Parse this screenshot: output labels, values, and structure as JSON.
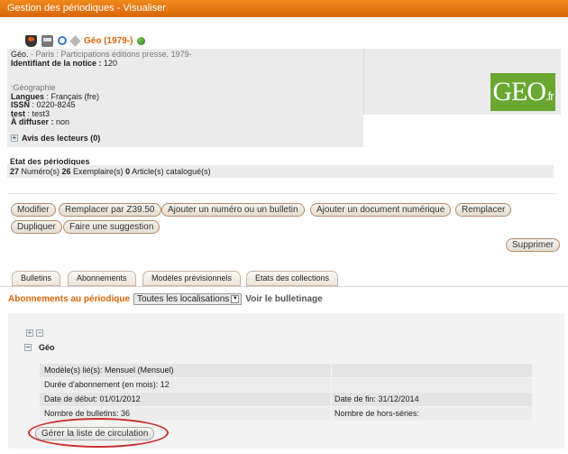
{
  "window": {
    "title": "Gestion des périodiques - Visualiser"
  },
  "notice": {
    "title": "Géo (1979-)",
    "icons": [
      "basket-icon",
      "print-icon",
      "search-icon",
      "tag-icon",
      "globe-icon"
    ],
    "line1_title": "Géo.",
    "line1_rest": " - Paris : Participations éditions presse, 1979-",
    "identifiant_label": "Identifiant de la notice :",
    "identifiant_value": " 120",
    "subject": ":Géographie",
    "langues_label": "Langues",
    "langues_value": " : Français (fre)",
    "issn_label": "ISSN",
    "issn_value": " : 0220-8245",
    "test_label": "test",
    "test_value": " : test3",
    "diffuser_label": "À diffuser :",
    "diffuser_value": " non",
    "logo_main": "GEO",
    "logo_suffix": ".fr"
  },
  "avis": {
    "label": "Avis des lecteurs (0)"
  },
  "etat": {
    "title": "Etat des périodiques",
    "num_count": "27",
    "num_label": " Numéro(s) ",
    "ex_count": "26",
    "ex_label": " Exemplaire(s) ",
    "art_count": "0",
    "art_label": " Article(s) catalogué(s)"
  },
  "actions": {
    "modifier": "Modifier",
    "remplacer_z3950": "Remplacer par Z39.50",
    "ajouter_numero": "Ajouter un numéro ou un bulletin",
    "ajouter_doc": "Ajouter un document numérique",
    "remplacer": "Remplacer",
    "dupliquer": "Dupliquer",
    "suggestion": "Faire une suggestion",
    "supprimer": "Supprimer"
  },
  "tabs": [
    "Bulletins",
    "Abonnements",
    "Modèles prévisionnels",
    "Etats des collections"
  ],
  "abonnements": {
    "label": "Abonnements au périodique",
    "select_value": "Toutes les localisations",
    "voir_label": "Voir le bulletinage",
    "node_title": "Géo",
    "rows": [
      {
        "left": "Modèle(s) lié(s): Mensuel (Mensuel)",
        "right": ""
      },
      {
        "left": "Durée d'abonnement (en mois): 12",
        "right": ""
      },
      {
        "left": "Date de début: 01/01/2012",
        "right": "Date de fin: 31/12/2014"
      },
      {
        "left": "Nombre de bulletins: 36",
        "right": "Nombre de hors-séries:"
      }
    ],
    "circulation_button": "Gérer la liste de circulation"
  },
  "colors": {
    "accent": "#d9650a",
    "titlebar": "#e8771a",
    "logo_green": "#6aa832",
    "highlight": "#c9302c"
  }
}
